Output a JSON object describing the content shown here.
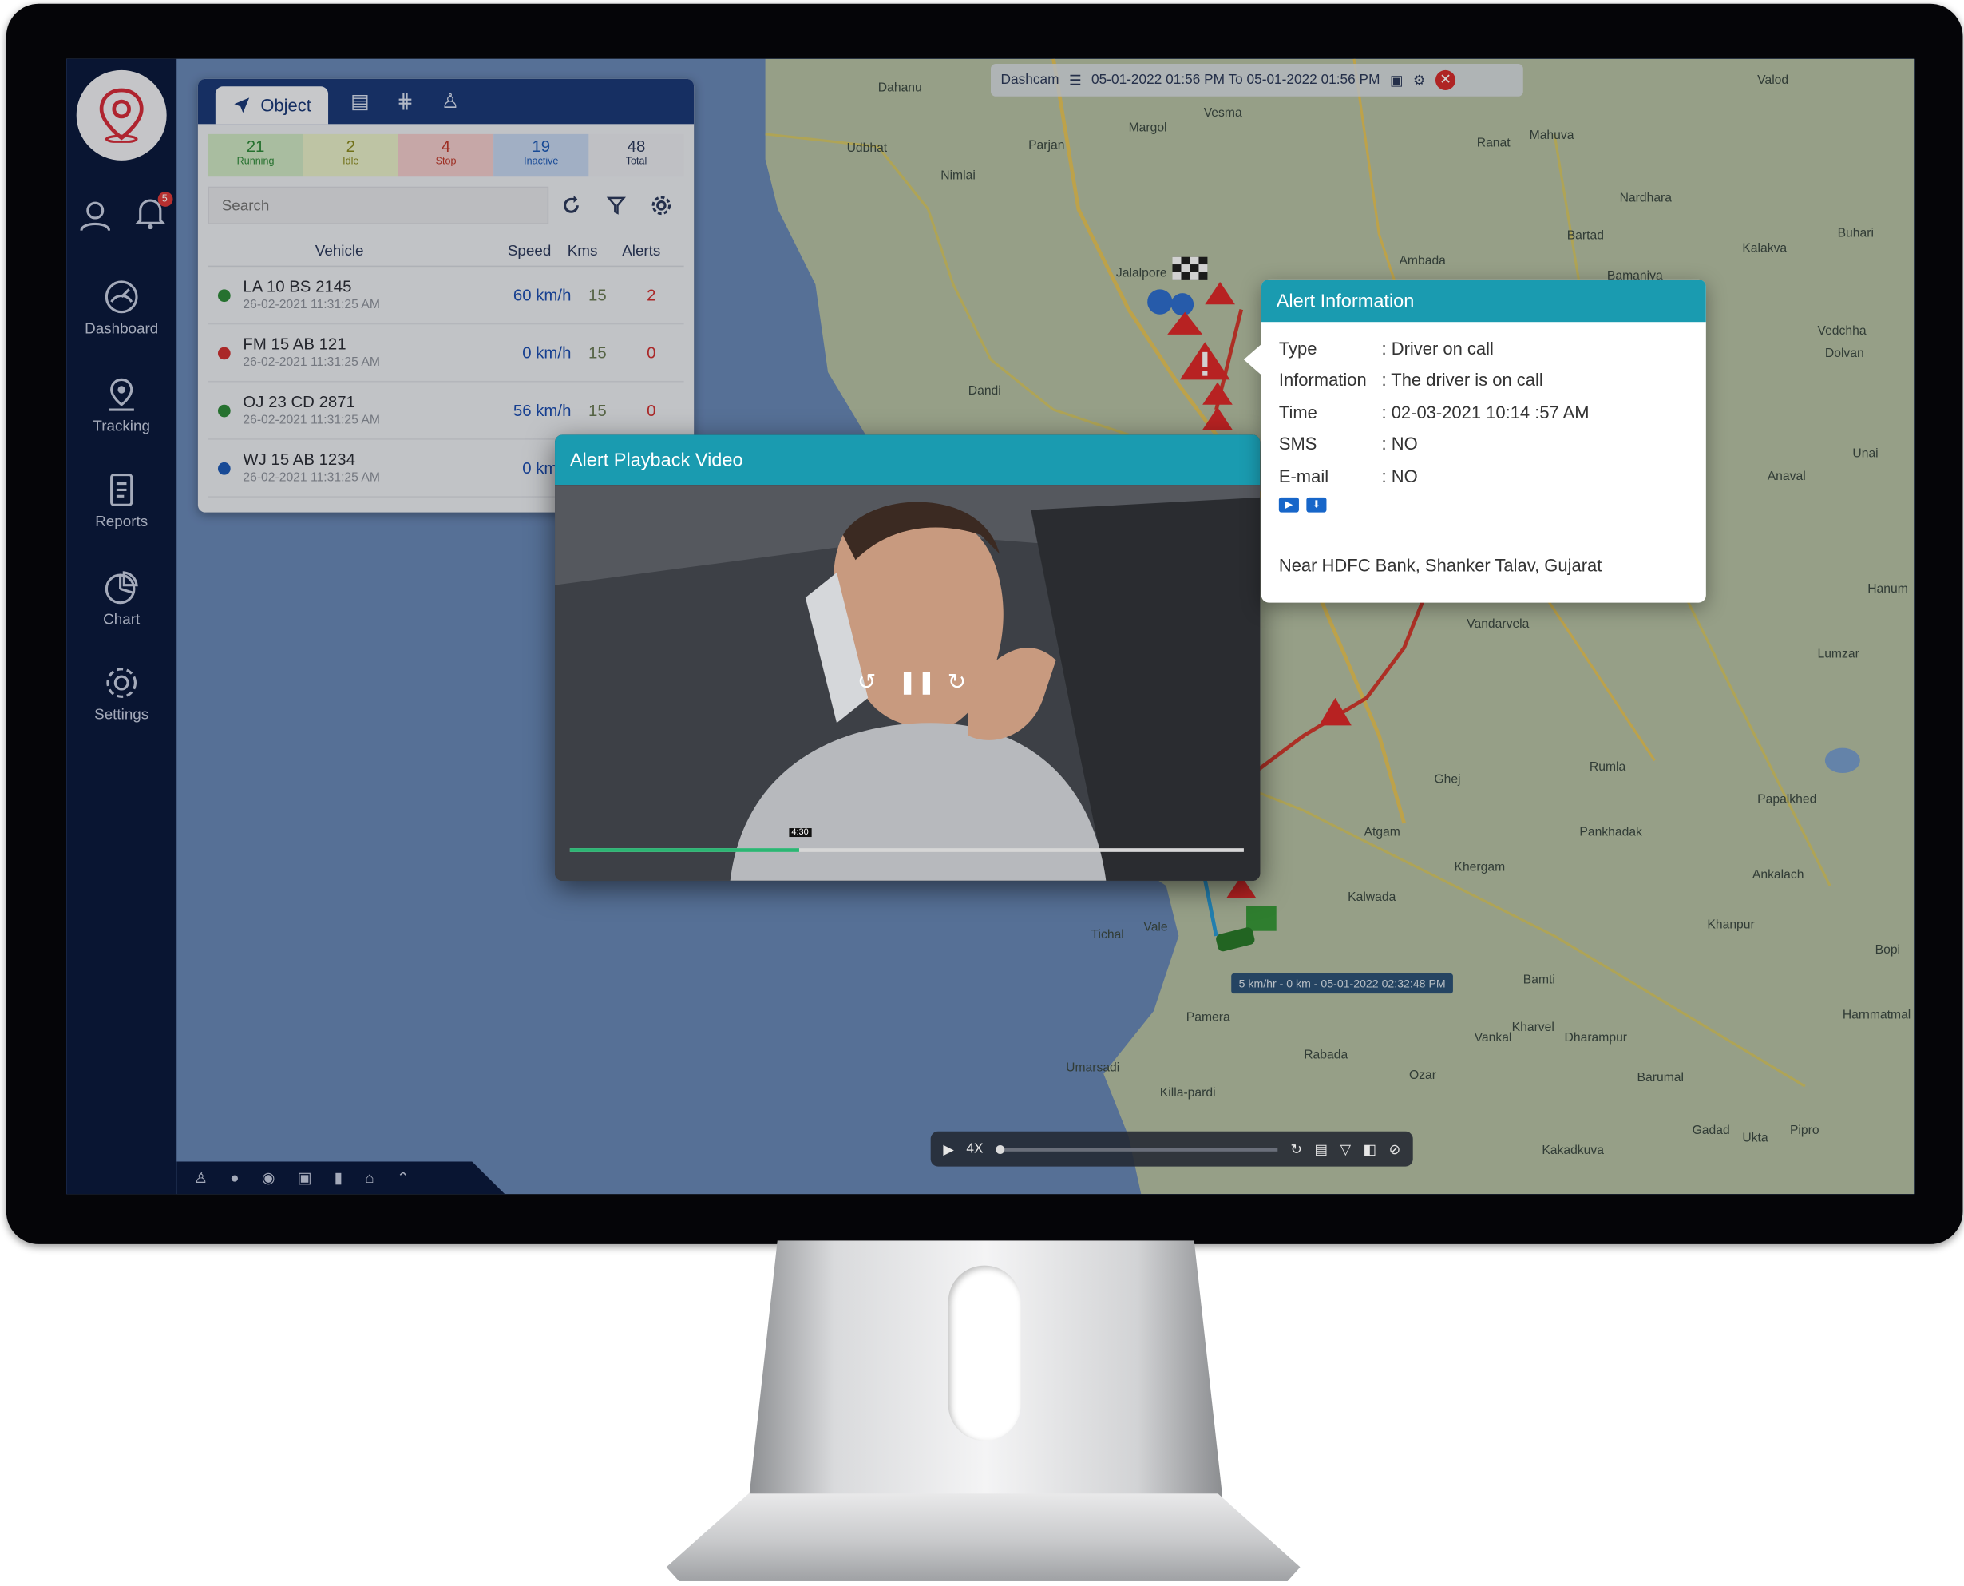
{
  "colors": {
    "sidebar": "#0c1a3d",
    "accent_teal": "#1a9bb0",
    "panel_header": "#1b3a78",
    "alert_red": "#e03b3b"
  },
  "sidebar": {
    "notification_count": "5",
    "items": [
      {
        "label": "Dashboard",
        "icon": "dashboard-icon"
      },
      {
        "label": "Tracking",
        "icon": "tracking-icon"
      },
      {
        "label": "Reports",
        "icon": "reports-icon"
      },
      {
        "label": "Chart",
        "icon": "chart-icon"
      },
      {
        "label": "Settings",
        "icon": "settings-icon"
      }
    ]
  },
  "objects_panel": {
    "active_tab": "Object",
    "stats": [
      {
        "count": "21",
        "label": "Running",
        "color": "#2f8a3a",
        "bg": "#cfe7c4"
      },
      {
        "count": "2",
        "label": "Idle",
        "color": "#8a8a1f",
        "bg": "#e8efc8"
      },
      {
        "count": "4",
        "label": "Stop",
        "color": "#c0392b",
        "bg": "#f2cccc"
      },
      {
        "count": "19",
        "label": "Inactive",
        "color": "#1e5bb8",
        "bg": "#c5d6f0"
      },
      {
        "count": "48",
        "label": "Total",
        "color": "#2c3a5c",
        "bg": "#e9ebef"
      }
    ],
    "search_placeholder": "Search",
    "columns": {
      "vehicle": "Vehicle",
      "speed": "Speed",
      "kms": "Kms",
      "alerts": "Alerts"
    },
    "vehicles": [
      {
        "plate": "LA 10 BS 2145",
        "timestamp": "26-02-2021 11:31:25 AM",
        "speed": "60 km/h",
        "kms": "15",
        "alerts": "2",
        "status_color": "#2f8a3a"
      },
      {
        "plate": "FM 15 AB 121",
        "timestamp": "26-02-2021 11:31:25 AM",
        "speed": "0 km/h",
        "kms": "15",
        "alerts": "0",
        "status_color": "#d03131"
      },
      {
        "plate": "OJ 23 CD 2871",
        "timestamp": "26-02-2021 11:31:25 AM",
        "speed": "56 km/h",
        "kms": "15",
        "alerts": "0",
        "status_color": "#2f8a3a"
      },
      {
        "plate": "WJ 15 AB 1234",
        "timestamp": "26-02-2021 11:31:25 AM",
        "speed": "0 km/h",
        "kms": "",
        "alerts": "",
        "status_color": "#1e5bb8"
      }
    ]
  },
  "map_topbar": {
    "label": "Dashcam",
    "date_range": "05-01-2022 01:56 PM To 05-01-2022 01:56 PM"
  },
  "video_popup": {
    "title": "Alert Playback Video",
    "time_tip": "4:30",
    "progress": 0.34
  },
  "alert_info": {
    "title": "Alert Information",
    "rows": [
      {
        "key": "Type",
        "value": ": Driver on call"
      },
      {
        "key": "Information",
        "value": ": The driver is on call"
      },
      {
        "key": "Time",
        "value": ": 02-03-2021 10:14 :57 AM"
      },
      {
        "key": "SMS",
        "value": ": NO"
      },
      {
        "key": "E-mail",
        "value": ": NO"
      }
    ],
    "address": "Near HDFC Bank, Shanker Talav, Gujarat"
  },
  "map_status_tip": "5 km/hr - 0 km - 05-01-2022 02:32:48 PM",
  "playback": {
    "speed": "4X"
  },
  "map_places": [
    "Dahanu",
    "Udbhat",
    "Nimlai",
    "Parjan",
    "Margol",
    "Vesma",
    "Ranat",
    "Mahuva",
    "Valod",
    "Nardhara",
    "Bartad",
    "Bamaniya",
    "Ambada",
    "Jalalpore",
    "Kalakva",
    "Buhari",
    "Dandi",
    "Vedchha",
    "Anaval",
    "Dolvan",
    "Unai",
    "Hanum",
    "Vandarvela",
    "Lumzar",
    "Rumla",
    "Ghej",
    "Atgam",
    "Khergam",
    "Pankhadak",
    "Papalkhed",
    "Ankalach",
    "Khanpur",
    "Kalwada",
    "Vale",
    "Tichal",
    "Pamera",
    "Rabada",
    "Vankal",
    "Kharvel",
    "Dharampur",
    "Bamti",
    "Harnmatmal",
    "Umarsadi",
    "Killa-pardi",
    "Ozar",
    "Barumal",
    "Gadad",
    "Ukta",
    "Pipro",
    "Kakadkuva",
    "Bopi"
  ]
}
